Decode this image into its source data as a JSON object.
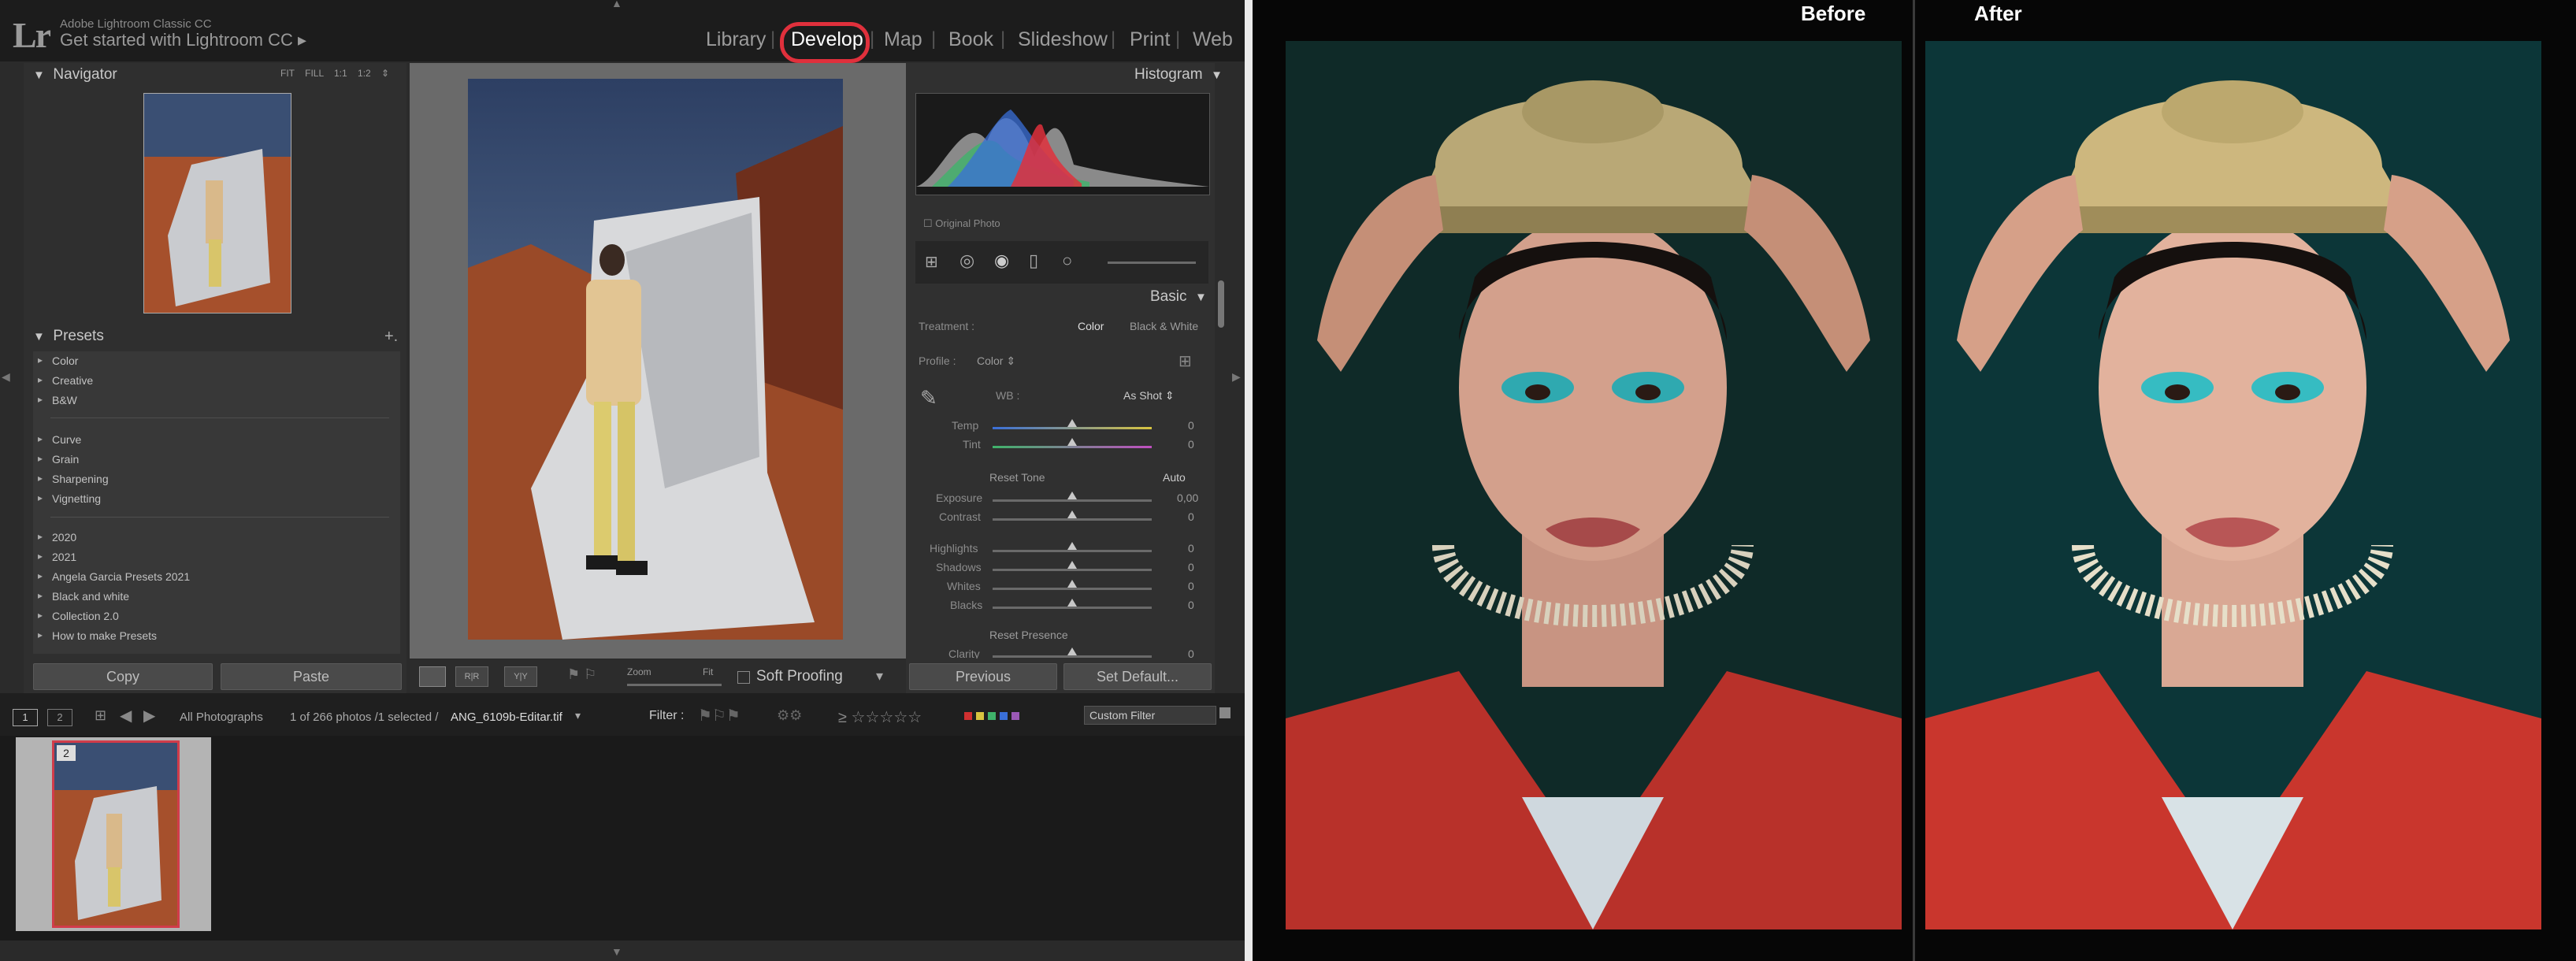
{
  "app": {
    "name": "Adobe Lightroom Classic CC",
    "getting_started": "Get started with Lightroom CC ▸",
    "logo": "Lr",
    "modules": [
      "Library",
      "Develop",
      "Map",
      "Book",
      "Slideshow",
      "Print",
      "Web"
    ],
    "active_module": "Develop",
    "accent_color": "#e0303c"
  },
  "navigator": {
    "title": "Navigator",
    "zoom_options": "FIT FILL 1:1 1:2 ⇕"
  },
  "presets": {
    "title": "Presets",
    "add": "+.",
    "groups": [
      [
        "Color",
        "Creative",
        "B&W"
      ],
      [
        "Curve",
        "Grain",
        "Sharpening",
        "Vignetting"
      ],
      [
        "2020",
        "2021",
        "Angela Garcia Presets 2021",
        "Black and white",
        "Collection 2.0",
        "How to make Presets"
      ]
    ]
  },
  "left_buttons": {
    "copy": "Copy",
    "paste": "Paste"
  },
  "toolbar": {
    "zoom": "Zoom",
    "fit": "Fit",
    "soft_proofing": "Soft Proofing"
  },
  "histogram": {
    "title": "Histogram",
    "original_photo": "Original Photo"
  },
  "basic": {
    "title": "Basic",
    "treatment_label": "Treatment :",
    "treatment_color": "Color",
    "treatment_bw": "Black & White",
    "profile_label": "Profile :",
    "profile_value": "Color ⇕",
    "wb_label": "WB :",
    "wb_value": "As Shot ⇕",
    "temp": {
      "label": "Temp",
      "value": "0"
    },
    "tint": {
      "label": "Tint",
      "value": "0"
    },
    "reset_tone": "Reset Tone",
    "auto": "Auto",
    "exposure": {
      "label": "Exposure",
      "value": "0,00"
    },
    "contrast": {
      "label": "Contrast",
      "value": "0"
    },
    "highlights": {
      "label": "Highlights",
      "value": "0"
    },
    "shadows": {
      "label": "Shadows",
      "value": "0"
    },
    "whites": {
      "label": "Whites",
      "value": "0"
    },
    "blacks": {
      "label": "Blacks",
      "value": "0"
    },
    "reset_presence": "Reset Presence",
    "clarity": {
      "label": "Clarity",
      "value": "0"
    }
  },
  "right_buttons": {
    "previous": "Previous",
    "set_default": "Set Default..."
  },
  "filmstrip": {
    "views": [
      "1",
      "2"
    ],
    "source": "All Photographs",
    "count": "1 of 266 photos /1 selected /",
    "filename": "ANG_6109b-Editar.tif",
    "filter_label": "Filter :",
    "custom_filter": "Custom Filter",
    "thumb_badge": "2"
  },
  "compare": {
    "before": "Before",
    "after": "After"
  }
}
